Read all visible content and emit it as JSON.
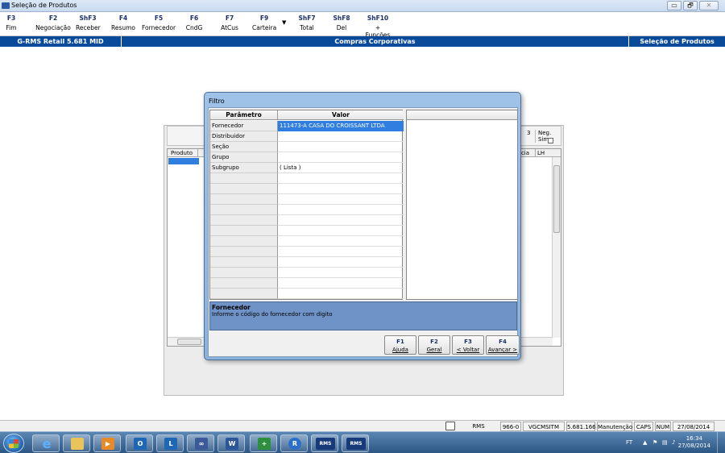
{
  "window": {
    "title": "Seleção de Produtos",
    "controls": [
      "▭",
      "🗗",
      "✕"
    ]
  },
  "toolbar": [
    {
      "key": "F3",
      "label": "Fim"
    },
    {
      "key": "F2",
      "label": "Negociação"
    },
    {
      "key": "ShF3",
      "label": "Receber"
    },
    {
      "key": "F4",
      "label": "Resumo"
    },
    {
      "key": "F5",
      "label": "Fornecedor"
    },
    {
      "key": "F6",
      "label": "CndG"
    },
    {
      "key": "F7",
      "label": "AtCus"
    },
    {
      "key": "F9",
      "label": "Carteira"
    },
    {
      "key": "ShF7",
      "label": "Total"
    },
    {
      "key": "ShF8",
      "label": "Del"
    },
    {
      "key": "ShF10",
      "label": "+ Funções"
    }
  ],
  "band": {
    "version": "G-RMS Retail 5.681 MID",
    "module": "Compras Corporativas",
    "screen": "Seleção de Produtos"
  },
  "background_panel": {
    "neg_prefix": "3",
    "neg_simp": "Neg. Simp.",
    "col_produto": "Produto",
    "col_ia": "icia",
    "col_lh": "LH"
  },
  "dialog": {
    "title": "Filtro",
    "col_parametro": "Parâmetro",
    "col_valor": "Valor",
    "rows": [
      {
        "param": "Fornecedor",
        "value": "111473-A CASA DO CROISSANT LTDA"
      },
      {
        "param": "Distribuidor",
        "value": ""
      },
      {
        "param": "Seção",
        "value": ""
      },
      {
        "param": "Grupo",
        "value": ""
      },
      {
        "param": "Subgrupo",
        "value": "( Lista )"
      },
      {
        "param": "",
        "value": ""
      },
      {
        "param": "",
        "value": ""
      },
      {
        "param": "",
        "value": ""
      },
      {
        "param": "",
        "value": ""
      },
      {
        "param": "",
        "value": ""
      },
      {
        "param": "",
        "value": ""
      },
      {
        "param": "",
        "value": ""
      },
      {
        "param": "",
        "value": ""
      },
      {
        "param": "",
        "value": ""
      },
      {
        "param": "",
        "value": ""
      },
      {
        "param": "",
        "value": ""
      },
      {
        "param": "",
        "value": ""
      }
    ],
    "help_title": "Fornecedor",
    "help_text": "Informe o código do fornecedor com digito",
    "buttons": [
      {
        "key": "F1",
        "label": "Ajuda"
      },
      {
        "key": "F2",
        "label": "Geral"
      },
      {
        "key": "F3",
        "label": "< Voltar"
      },
      {
        "key": "F4",
        "label": "Avançar >"
      }
    ]
  },
  "statusbar": {
    "system": "RMS",
    "code": "966-0",
    "user": "VGCMSITM",
    "version": "5.681.166",
    "mode": "Manutenção",
    "caps": "CAPS",
    "num": "NUM",
    "date": "27/08/2014"
  },
  "taskbar": {
    "apps": [
      "start",
      "ie",
      "explorer",
      "media",
      "outlook",
      "lync",
      "app",
      "word",
      "addon",
      "rms-alt",
      "RMS",
      "RMS"
    ],
    "tray_lang": "FT",
    "time": "16:34",
    "date": "27/08/2014"
  },
  "colors": {
    "band_blue": "#0a4a9b",
    "selection_blue": "#2f7ee0",
    "help_blue": "#6f93c6"
  }
}
